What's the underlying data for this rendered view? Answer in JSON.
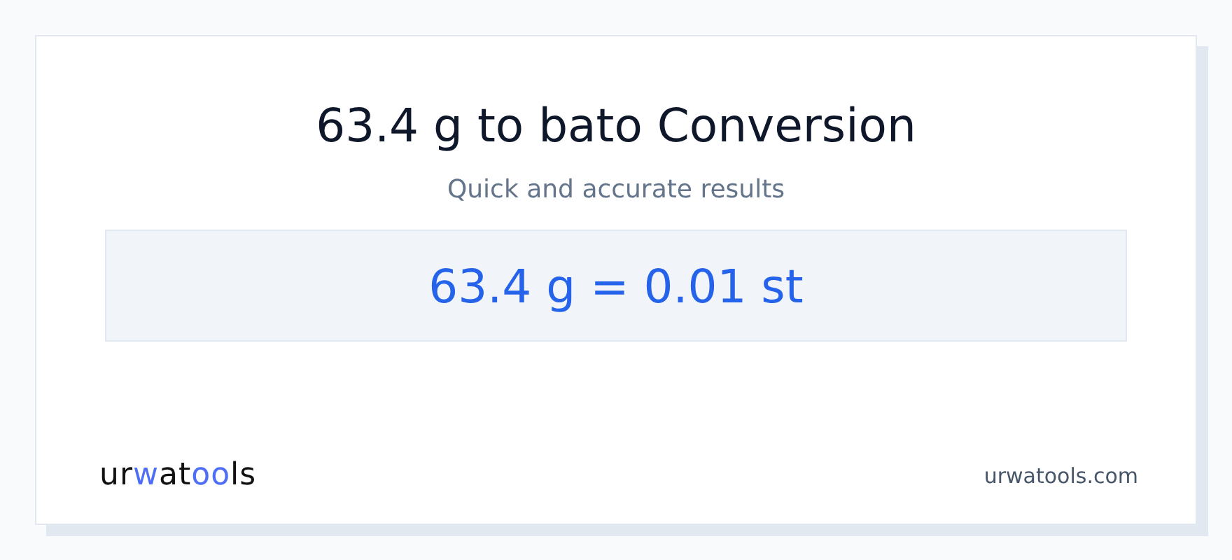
{
  "title": "63.4 g to bato Conversion",
  "subtitle": "Quick and accurate results",
  "result": "63.4 g = 0.01 st",
  "logo": [
    {
      "text": "ur",
      "accent": false
    },
    {
      "text": "w",
      "accent": true
    },
    {
      "text": "at",
      "accent": false
    },
    {
      "text": "oo",
      "accent": true
    },
    {
      "text": "ls",
      "accent": false
    }
  ],
  "site": "urwatools.com"
}
